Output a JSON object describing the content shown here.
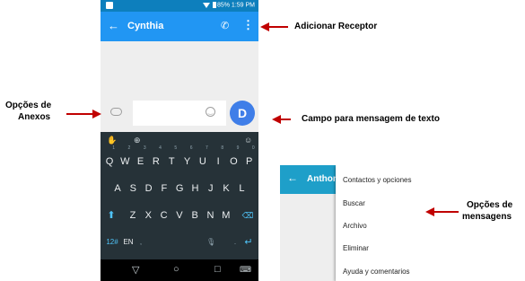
{
  "phone_main": {
    "status_time": "1:59 PM",
    "battery_text": "85%",
    "contact_name": "Cynthia",
    "send_avatar_letter": "D",
    "keyboard": {
      "row1": [
        {
          "k": "Q",
          "n": "1"
        },
        {
          "k": "W",
          "n": "2"
        },
        {
          "k": "E",
          "n": "3"
        },
        {
          "k": "R",
          "n": "4"
        },
        {
          "k": "T",
          "n": "5"
        },
        {
          "k": "Y",
          "n": "6"
        },
        {
          "k": "U",
          "n": "7"
        },
        {
          "k": "I",
          "n": "8"
        },
        {
          "k": "O",
          "n": "9"
        },
        {
          "k": "P",
          "n": "0"
        }
      ],
      "row2": [
        "A",
        "S",
        "D",
        "F",
        "G",
        "H",
        "J",
        "K",
        "L"
      ],
      "row3": [
        "Z",
        "X",
        "C",
        "V",
        "B",
        "N",
        "M"
      ],
      "sym_key": "12#",
      "lang_key": "EN"
    }
  },
  "phone_menu": {
    "contact_name": "Anthon",
    "menu_items": [
      "Contactos y opciones",
      "Buscar",
      "Archivo",
      "Eliminar",
      "Ayuda y comentarios"
    ]
  },
  "callouts": {
    "add_receiver": "Adicionar Receptor",
    "attach_options_line1": "Opções de",
    "attach_options_line2": "Anexos",
    "text_field": "Campo para mensagem de texto",
    "message_options_line1": "Opções de",
    "message_options_line2": "mensagens"
  },
  "colors": {
    "toolbar_blue": "#2196f3",
    "status_blue": "#0d7fbd",
    "arrow_red": "#c00000",
    "send_button_blue": "#3f7ee8",
    "keyboard_bg": "#263238"
  }
}
